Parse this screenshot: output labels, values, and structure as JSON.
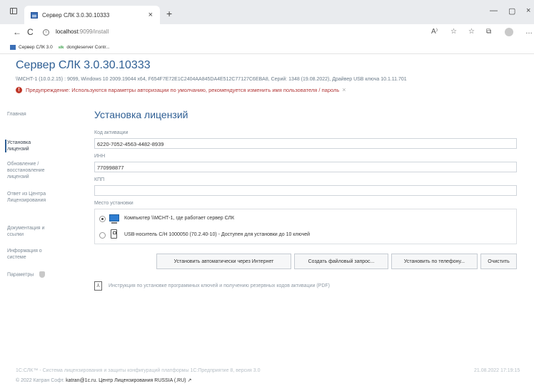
{
  "browser": {
    "tab_title": "Сервер СЛК 3.0.30.10333",
    "tab_close": "×",
    "new_tab": "+",
    "minimize": "—",
    "maximize": "▢",
    "close": "×",
    "back": "←",
    "reload": "C",
    "url_host": "localhost",
    "url_path": ":9099/install",
    "favorites": [
      {
        "label": "Сервер СЛК 3.0",
        "icon": "slk-favicon"
      },
      {
        "label": "dongleserver Contr...",
        "icon": "slk-green-favicon",
        "badge": "slk"
      }
    ]
  },
  "header": {
    "title": "Сервер СЛК 3.0.30.10333",
    "sysinfo": "\\\\МСНТ-1 (10.0.2.15) : 9099,  Windows 10 2009.19044 x64,  F654F7E72E1C2404AA845DA4E512C77127C6EBA8,  Серий: 1348 (19.08.2022),  Драйвер USB ключа 10.1.11.701",
    "warning": "Предупреждение: Используются параметры авторизации по умолчанию, рекомендуется изменить имя пользователя / пароль",
    "warning_icon_glyph": "!",
    "warning_close": "×"
  },
  "sidebar": {
    "items": [
      {
        "label": "Главная",
        "active": false
      },
      {
        "label": "Установка лицензий",
        "active": true
      },
      {
        "label": "Обновление / восстановление лицензий",
        "active": false
      },
      {
        "label": "Ответ из Центра Лицензирования",
        "active": false
      },
      {
        "label": "Документация и ссылки",
        "active": false
      },
      {
        "label": "Информация о системе",
        "active": false
      },
      {
        "label": "Параметры",
        "active": false
      }
    ]
  },
  "main": {
    "title": "Установка лицензий",
    "fields": [
      {
        "label": "Код активации",
        "value": "6220-7052-4563-4482-8939"
      },
      {
        "label": "ИНН",
        "value": "770998877"
      },
      {
        "label": "КПП",
        "value": ""
      }
    ],
    "location_label": "Место установки",
    "options": [
      {
        "label": "Компьютер \\\\МСНТ-1, где работает сервер СЛК",
        "selected": true
      },
      {
        "label": "USB-носитель С/Н 1000050 (70.2.40-10) - Доступен для установки до 10 ключей",
        "selected": false
      }
    ],
    "buttons": [
      "Установить автоматически через Интернет",
      "Создать файловый запрос...",
      "Установить по телефону...",
      "Очистить"
    ],
    "pdf_link": "Инструкция по установке программных ключей и получению резервных кодов активации (PDF)"
  },
  "footer": {
    "line1": "1С:СЛК™ - Система лицензирования и защиты конфигураций платформы 1С:Предприятие 8, версия 3.0",
    "date": "21.08.2022 17:19:15",
    "copyright": "© 2022 Катран Софт.",
    "email": "katran@1c.ru.",
    "center": "Центр Лицензирования RUSSIA (.RU)"
  },
  "colors": {
    "accent": "#2f5f94",
    "warning": "#b23a3a",
    "muted": "#7d8a96"
  }
}
